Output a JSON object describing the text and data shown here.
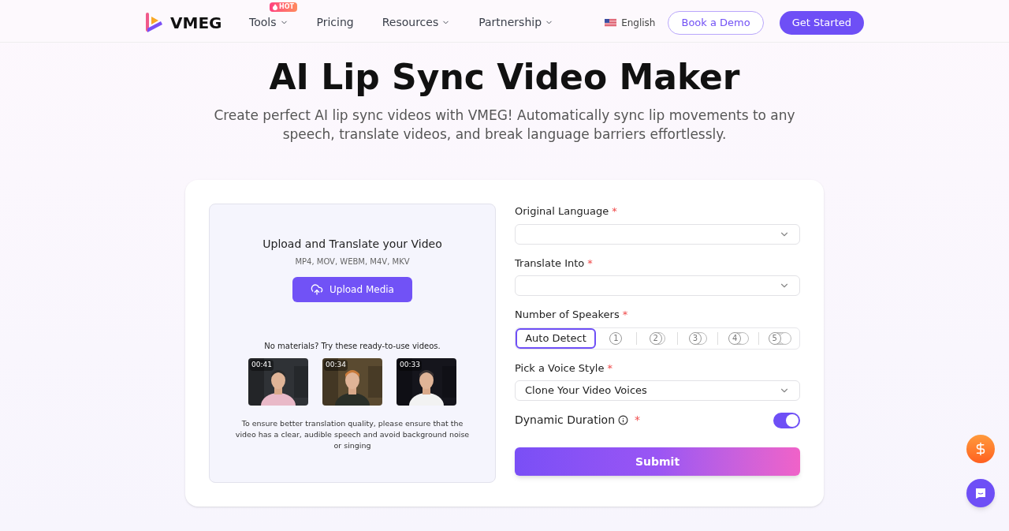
{
  "nav": {
    "brand": "VMEG",
    "items": [
      {
        "label": "Tools",
        "dropdown": true,
        "badge": "HOT"
      },
      {
        "label": "Pricing",
        "dropdown": false
      },
      {
        "label": "Resources",
        "dropdown": true
      },
      {
        "label": "Partnership",
        "dropdown": true
      }
    ],
    "language": "English",
    "demo_button": "Book a Demo",
    "start_button": "Get Started"
  },
  "hero": {
    "title": "AI Lip Sync Video Maker",
    "subtitle": "Create perfect AI lip sync videos with VMEG! Automatically sync lip movements to any speech, translate videos, and break language barriers effortlessly."
  },
  "upload": {
    "title": "Upload and Translate your Video",
    "formats": "MP4, MOV, WEBM, M4V, MKV",
    "button": "Upload Media",
    "samples_label": "No materials? Try these ready-to-use videos.",
    "samples": [
      {
        "duration": "00:41",
        "kind": "picture"
      },
      {
        "duration": "00:34",
        "kind": "picture"
      },
      {
        "duration": "00:33",
        "kind": "picture"
      }
    ],
    "note": "To ensure better translation quality, please ensure that the video has a clear, audible speech and avoid background noise or singing"
  },
  "form": {
    "original_language": {
      "label": "Original Language",
      "required_mark": "*"
    },
    "translate_into": {
      "label": "Translate Into",
      "required_mark": "*"
    },
    "speakers": {
      "label": "Number of Speakers",
      "required_mark": "*",
      "options": [
        {
          "kind": "text",
          "label": "Auto Detect",
          "selected": true
        },
        {
          "kind": "count",
          "label": "1",
          "selected": false
        },
        {
          "kind": "count",
          "label": "2",
          "selected": false
        },
        {
          "kind": "count",
          "label": "3",
          "selected": false
        },
        {
          "kind": "count",
          "label": "4",
          "selected": false
        },
        {
          "kind": "count",
          "label": "5",
          "selected": false
        }
      ]
    },
    "voice_style": {
      "label": "Pick a Voice Style",
      "required_mark": "*",
      "value": "Clone Your Video Voices"
    },
    "dynamic_duration": {
      "label": "Dynamic Duration",
      "required_mark": "*",
      "on": true
    },
    "submit": "Submit"
  }
}
